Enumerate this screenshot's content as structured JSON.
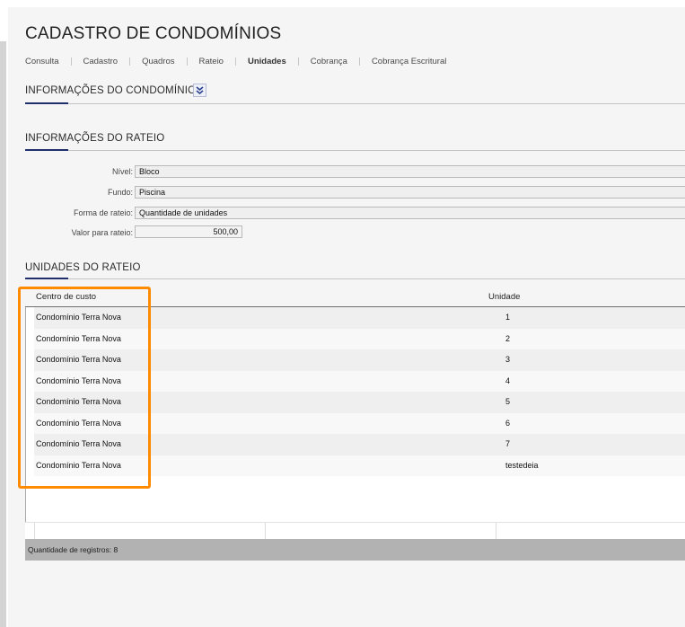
{
  "page": {
    "title": "CADASTRO DE CONDOMÍNIOS"
  },
  "tabs": [
    {
      "label": "Consulta"
    },
    {
      "label": "Cadastro"
    },
    {
      "label": "Quadros"
    },
    {
      "label": "Rateio"
    },
    {
      "label": "Unidades",
      "active": true
    },
    {
      "label": "Cobrança"
    },
    {
      "label": "Cobrança Escritural"
    }
  ],
  "sections": {
    "condominio": {
      "title": "INFORMAÇÕES DO CONDOMÍNIO",
      "collapse_icon": "double-chevron-down-icon"
    },
    "rateio": {
      "title": "INFORMAÇÕES DO RATEIO"
    },
    "unidades": {
      "title": "UNIDADES DO RATEIO"
    }
  },
  "form": {
    "nivel": {
      "label": "Nível:",
      "value": "Bloco"
    },
    "fundo": {
      "label": "Fundo:",
      "value": "Piscina"
    },
    "forma_rateio": {
      "label": "Forma de rateio:",
      "value": "Quantidade de unidades"
    },
    "valor_rateio": {
      "label": "Valor para rateio:",
      "value": "500,00"
    }
  },
  "grid": {
    "columns": [
      "Centro de custo",
      "Unidade"
    ],
    "rows": [
      [
        "Condomínio Terra Nova",
        "1"
      ],
      [
        "Condomínio Terra Nova",
        "2"
      ],
      [
        "Condomínio Terra Nova",
        "3"
      ],
      [
        "Condomínio Terra Nova",
        "4"
      ],
      [
        "Condomínio Terra Nova",
        "5"
      ],
      [
        "Condomínio Terra Nova",
        "6"
      ],
      [
        "Condomínio Terra Nova",
        "7"
      ],
      [
        "Condomínio Terra Nova",
        "testedeia"
      ]
    ],
    "status": "Quantidade de registros: 8"
  },
  "colors": {
    "accent": "#1f2f6b",
    "highlight": "#ff8c00",
    "status_bar": "#b2b2b2"
  }
}
